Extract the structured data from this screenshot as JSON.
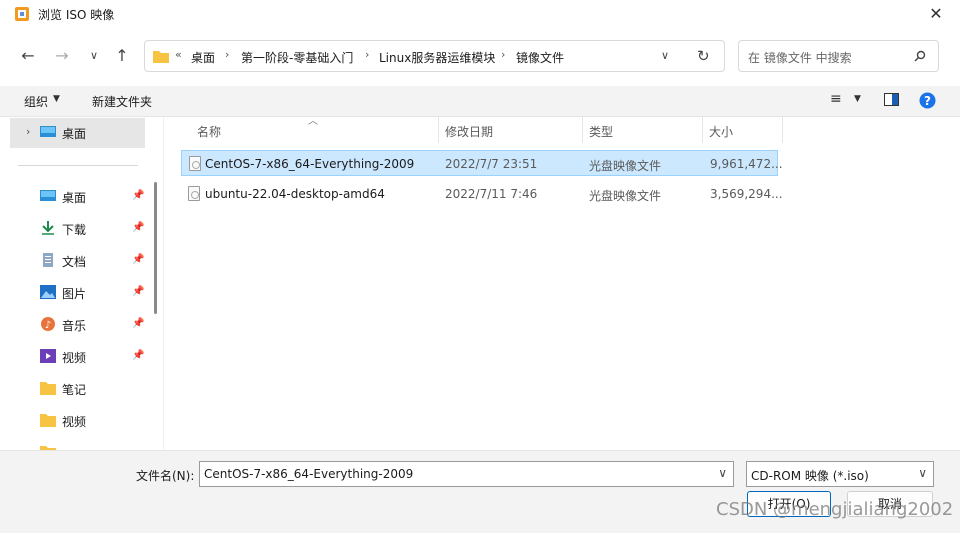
{
  "window": {
    "title": "浏览 ISO 映像"
  },
  "breadcrumb": {
    "overflow": "«",
    "items": [
      "桌面",
      "第一阶段-零基础入门",
      "Linux服务器运维模块",
      "镜像文件"
    ]
  },
  "search": {
    "placeholder": "在 镜像文件 中搜索"
  },
  "toolbar": {
    "organize": "组织",
    "new_folder": "新建文件夹"
  },
  "nav": {
    "top_item": "桌面",
    "quick": [
      {
        "label": "桌面",
        "pinned": true
      },
      {
        "label": "下载",
        "pinned": true
      },
      {
        "label": "文档",
        "pinned": true
      },
      {
        "label": "图片",
        "pinned": true
      },
      {
        "label": "音乐",
        "pinned": true
      },
      {
        "label": "视频",
        "pinned": true
      },
      {
        "label": "笔记",
        "pinned": false
      },
      {
        "label": "视频",
        "pinned": false
      }
    ]
  },
  "columns": {
    "name": "名称",
    "date": "修改日期",
    "type": "类型",
    "size": "大小"
  },
  "files": [
    {
      "name": "CentOS-7-x86_64-Everything-2009",
      "date": "2022/7/7 23:51",
      "type": "光盘映像文件",
      "size": "9,961,472...",
      "selected": true
    },
    {
      "name": "ubuntu-22.04-desktop-amd64",
      "date": "2022/7/11 7:46",
      "type": "光盘映像文件",
      "size": "3,569,294...",
      "selected": false
    }
  ],
  "footer": {
    "filename_label": "文件名(N):",
    "filename_value": "CentOS-7-x86_64-Everything-2009",
    "filter_value": "CD-ROM 映像 (*.iso)",
    "open_label": "打开(O)",
    "cancel_label": "取消"
  },
  "watermark": "CSDN @mengjialiang2002",
  "colors": {
    "selection": "#cce8ff",
    "selection_border": "#99d1ff",
    "accent": "#0067c0",
    "folder": "#f6c343"
  }
}
